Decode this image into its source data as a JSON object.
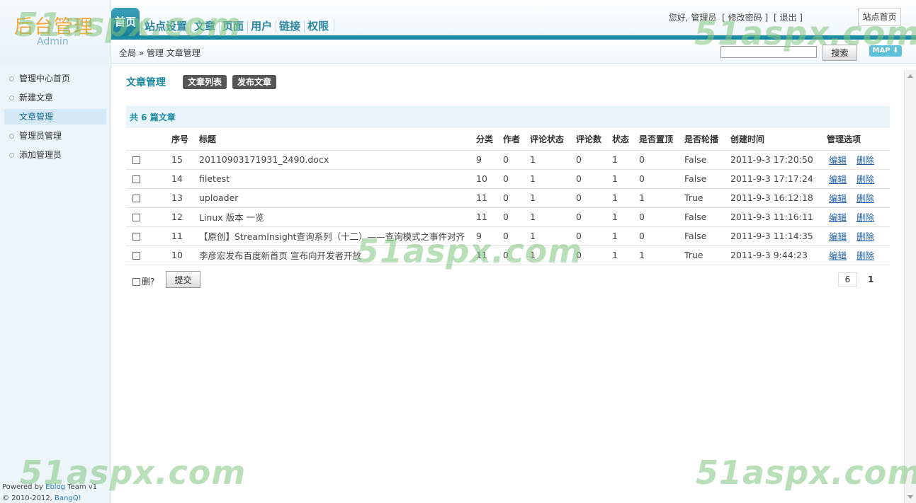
{
  "logo": {
    "title": "后台管理",
    "subtitle": "Admin"
  },
  "nav": {
    "items": [
      {
        "label": "首页",
        "active": true
      },
      {
        "label": "站点设置",
        "active": false
      },
      {
        "label": "文章",
        "active": false
      },
      {
        "label": "页面",
        "active": false
      },
      {
        "label": "用户",
        "active": false
      },
      {
        "label": "链接",
        "active": false
      },
      {
        "label": "权限",
        "active": false
      }
    ]
  },
  "userbar": {
    "greeting": "您好, 管理员",
    "change_password": "[ 修改密码 ]",
    "logout": "[ 退出 ]",
    "site_home": "站点首页"
  },
  "breadcrumb": "全局 » 管理 文章管理",
  "search": {
    "value": "",
    "button": "搜索",
    "map_label": "MAP ⬇"
  },
  "sidebar": {
    "items": [
      {
        "label": "管理中心首页",
        "active": false
      },
      {
        "label": "新建文章",
        "active": false
      },
      {
        "label": "文章管理",
        "active": true
      },
      {
        "label": "管理员管理",
        "active": false
      },
      {
        "label": "添加管理员",
        "active": false
      }
    ],
    "footer_line1_prefix": "Powered by ",
    "footer_line1_link": "Eblog",
    "footer_line1_suffix": " Team v1",
    "footer_line2_prefix": "© 2010-2012, ",
    "footer_line2_link": "BangQ!"
  },
  "content": {
    "title": "文章管理",
    "list_button": "文章列表",
    "publish_button": "发布文章",
    "summary": "共 6 篇文章"
  },
  "table": {
    "headers": [
      "",
      "序号",
      "标题",
      "分类",
      "作者",
      "评论状态",
      "评论数",
      "状态",
      "是否置顶",
      "是否轮播",
      "创建时间",
      "管理选项"
    ],
    "edit_label": "编辑",
    "delete_label": "删除",
    "rows": [
      {
        "id": "15",
        "title": "20110903171931_2490.docx",
        "category": "9",
        "author": "0",
        "comment_status": "1",
        "comments": "0",
        "status": "1",
        "top": "0",
        "carousel": "False",
        "created": "2011-9-3 17:20:50"
      },
      {
        "id": "14",
        "title": "filetest",
        "category": "10",
        "author": "0",
        "comment_status": "1",
        "comments": "0",
        "status": "1",
        "top": "0",
        "carousel": "False",
        "created": "2011-9-3 17:17:24"
      },
      {
        "id": "13",
        "title": "uploader",
        "category": "11",
        "author": "0",
        "comment_status": "1",
        "comments": "0",
        "status": "1",
        "top": "1",
        "carousel": "True",
        "created": "2011-9-3 16:12:18"
      },
      {
        "id": "12",
        "title": "Linux 版本 一览",
        "category": "11",
        "author": "0",
        "comment_status": "1",
        "comments": "0",
        "status": "1",
        "top": "0",
        "carousel": "False",
        "created": "2011-9-3 11:16:11"
      },
      {
        "id": "11",
        "title": "【原创】StreamInsight查询系列（十二）——查询模式之事件对齐",
        "category": "9",
        "author": "0",
        "comment_status": "1",
        "comments": "0",
        "status": "1",
        "top": "0",
        "carousel": "False",
        "created": "2011-9-3 11:14:35"
      },
      {
        "id": "10",
        "title": "李彦宏发布百度新首页 宣布向开发者开放",
        "category": "11",
        "author": "0",
        "comment_status": "1",
        "comments": "0",
        "status": "1",
        "top": "1",
        "carousel": "True",
        "created": "2011-9-3 9:44:23"
      }
    ]
  },
  "bottom": {
    "delete_label": "删?",
    "submit_label": "提交",
    "total_count": "6",
    "current_page": "1"
  },
  "watermark": "51aspx.com"
}
